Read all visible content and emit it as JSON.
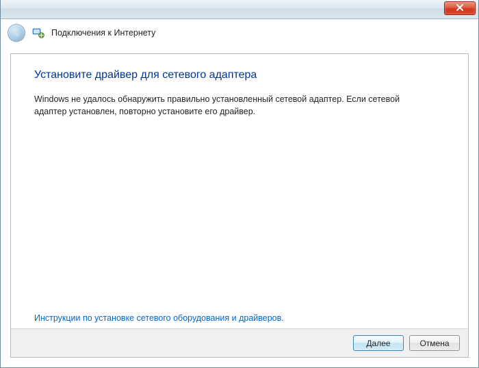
{
  "titlebar": {
    "close_icon": "close"
  },
  "navbar": {
    "wizard_title": "Подключения к Интернету"
  },
  "page": {
    "heading": "Установите драйвер для сетевого адаптера",
    "body": "Windows не удалось обнаружить правильно установленный сетевой адаптер. Если сетевой адаптер установлен, повторно установите его драйвер.",
    "help_link": "Инструкции по установке сетевого оборудования и драйверов."
  },
  "buttons": {
    "next": "Далее",
    "cancel": "Отмена"
  }
}
